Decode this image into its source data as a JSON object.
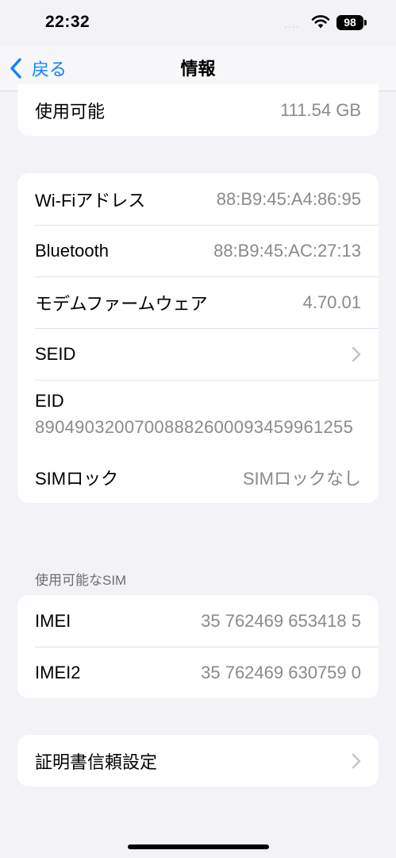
{
  "status_bar": {
    "time": "22:32",
    "signal": "....",
    "battery": "98"
  },
  "nav": {
    "back_label": "戻る",
    "title": "情報"
  },
  "storage": {
    "available_label": "使用可能",
    "available_value": "111.54 GB"
  },
  "network": {
    "wifi_label": "Wi-Fiアドレス",
    "wifi_value": "88:B9:45:A4:86:95",
    "bluetooth_label": "Bluetooth",
    "bluetooth_value": "88:B9:45:AC:27:13",
    "modem_label": "モデムファームウェア",
    "modem_value": "4.70.01",
    "seid_label": "SEID",
    "eid_label": "EID",
    "eid_value": "89049032007008882600093459961255",
    "simlock_label": "SIMロック",
    "simlock_value": "SIMロックなし"
  },
  "sim_section": {
    "header": "使用可能なSIM",
    "imei_label": "IMEI",
    "imei_value": "35 762469 653418 5",
    "imei2_label": "IMEI2",
    "imei2_value": "35 762469 630759 0"
  },
  "certificates": {
    "label": "証明書信頼設定"
  },
  "colors": {
    "accent": "#0a84ff",
    "background": "#f2f2f7",
    "secondary_text": "#8a8a8e"
  }
}
